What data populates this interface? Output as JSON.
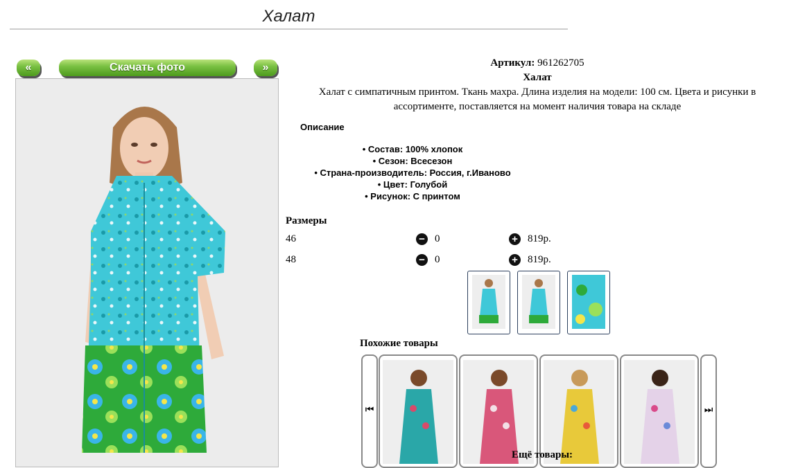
{
  "page": {
    "title": "Халат"
  },
  "gallery": {
    "prev_label": "«",
    "download_label": "Скачать фото",
    "next_label": "»"
  },
  "product": {
    "article_label": "Артикул:",
    "article_value": "961262705",
    "name": "Халат",
    "description": "Халат с симпатичным принтом. Ткань махра. Длина изделия на модели: 100 см. Цвета и рисунки в ассортименте, поставляется на момент наличия товара на складе",
    "details_heading": "Описание",
    "features": [
      "Состав: 100% хлопок",
      "Сезон: Всесезон",
      "Страна-производитель: Россия, г.Иваново",
      "Цвет: Голубой",
      "Рисунок: С принтом"
    ]
  },
  "sizes": {
    "heading": "Размеры",
    "rows": [
      {
        "size": "46",
        "qty": "0",
        "price": "819р."
      },
      {
        "size": "48",
        "qty": "0",
        "price": "819р."
      }
    ],
    "minus_icon": "minus-circle-icon",
    "plus_icon": "plus-circle-icon"
  },
  "similar": {
    "heading": "Похожие товары",
    "more_label": "Ещё товары:"
  },
  "colors": {
    "accent_green": "#7ac143",
    "thumb_border": "#2b3f5c",
    "dress_turquoise": "#3fc8d8",
    "print_green": "#2eaa3a"
  }
}
